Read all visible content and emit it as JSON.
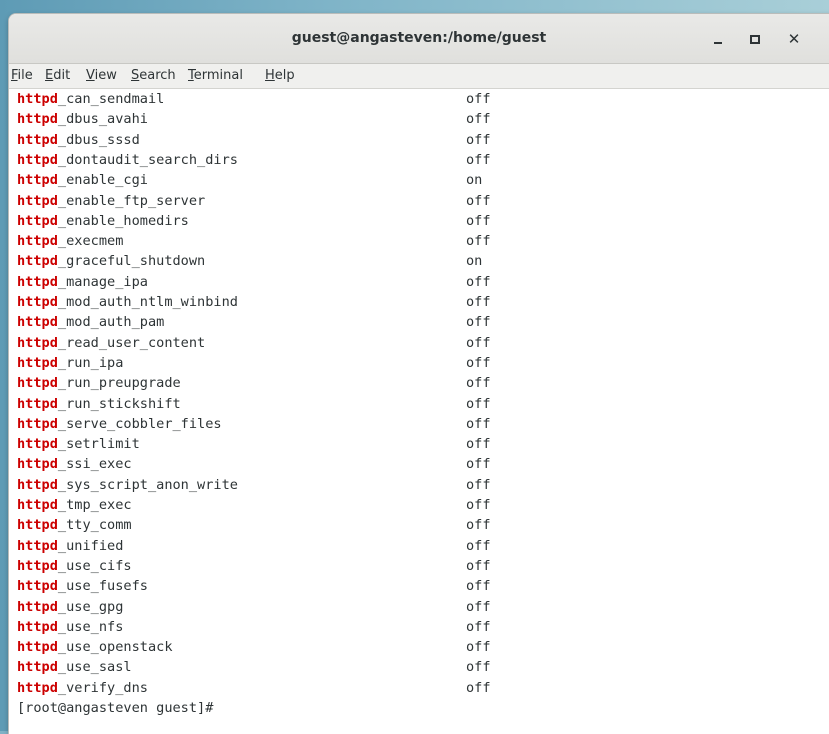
{
  "window": {
    "title": "guest@angasteven:/home/guest"
  },
  "menubar": {
    "items": [
      {
        "mnemonic": "F",
        "rest": "ile"
      },
      {
        "mnemonic": "E",
        "rest": "dit"
      },
      {
        "mnemonic": "V",
        "rest": "iew"
      },
      {
        "mnemonic": "S",
        "rest": "earch"
      },
      {
        "mnemonic": "T",
        "rest": "erminal"
      },
      {
        "mnemonic": "H",
        "rest": "elp"
      }
    ]
  },
  "terminal": {
    "prefix": "httpd",
    "rows": [
      {
        "name": "_can_sendmail",
        "value": "off"
      },
      {
        "name": "_dbus_avahi",
        "value": "off"
      },
      {
        "name": "_dbus_sssd",
        "value": "off"
      },
      {
        "name": "_dontaudit_search_dirs",
        "value": "off"
      },
      {
        "name": "_enable_cgi",
        "value": "on"
      },
      {
        "name": "_enable_ftp_server",
        "value": "off"
      },
      {
        "name": "_enable_homedirs",
        "value": "off"
      },
      {
        "name": "_execmem",
        "value": "off"
      },
      {
        "name": "_graceful_shutdown",
        "value": "on"
      },
      {
        "name": "_manage_ipa",
        "value": "off"
      },
      {
        "name": "_mod_auth_ntlm_winbind",
        "value": "off"
      },
      {
        "name": "_mod_auth_pam",
        "value": "off"
      },
      {
        "name": "_read_user_content",
        "value": "off"
      },
      {
        "name": "_run_ipa",
        "value": "off"
      },
      {
        "name": "_run_preupgrade",
        "value": "off"
      },
      {
        "name": "_run_stickshift",
        "value": "off"
      },
      {
        "name": "_serve_cobbler_files",
        "value": "off"
      },
      {
        "name": "_setrlimit",
        "value": "off"
      },
      {
        "name": "_ssi_exec",
        "value": "off"
      },
      {
        "name": "_sys_script_anon_write",
        "value": "off"
      },
      {
        "name": "_tmp_exec",
        "value": "off"
      },
      {
        "name": "_tty_comm",
        "value": "off"
      },
      {
        "name": "_unified",
        "value": "off"
      },
      {
        "name": "_use_cifs",
        "value": "off"
      },
      {
        "name": "_use_fusefs",
        "value": "off"
      },
      {
        "name": "_use_gpg",
        "value": "off"
      },
      {
        "name": "_use_nfs",
        "value": "off"
      },
      {
        "name": "_use_openstack",
        "value": "off"
      },
      {
        "name": "_use_sasl",
        "value": "off"
      },
      {
        "name": "_verify_dns",
        "value": "off"
      }
    ],
    "prompt": "[root@angasteven guest]#"
  },
  "colors": {
    "keyword": "#cc0000",
    "text": "#2e3436",
    "titlebar": "#e4e4e1"
  },
  "icons": [
    "minimize-icon",
    "maximize-icon",
    "close-icon"
  ]
}
